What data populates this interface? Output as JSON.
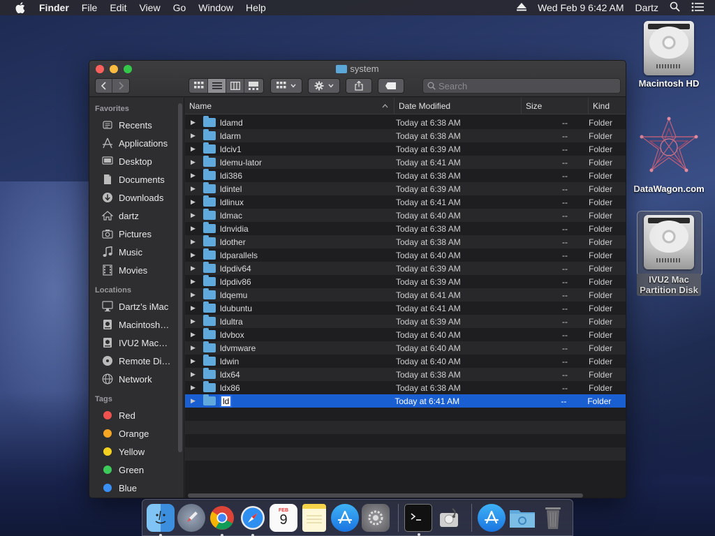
{
  "menubar": {
    "app_name": "Finder",
    "menus": [
      "File",
      "Edit",
      "View",
      "Go",
      "Window",
      "Help"
    ],
    "clock": "Wed Feb 9  6:42 AM",
    "user": "Dartz"
  },
  "desktop": {
    "icons": [
      {
        "label": "Macintosh HD",
        "icon": "hard-drive-icon"
      },
      {
        "label": "DataWagon.com",
        "icon": "star-mesh-icon"
      },
      {
        "label_line1": "IVU2 Mac",
        "label_line2": "Partition Disk",
        "icon": "hard-drive-icon",
        "selected": true
      }
    ]
  },
  "window": {
    "title": "system",
    "search_placeholder": "Search",
    "toolbar": {
      "view_modes": [
        "icon-view",
        "list-view",
        "column-view",
        "gallery-view"
      ],
      "active_view": "list-view"
    }
  },
  "sidebar": {
    "favorites_label": "Favorites",
    "favorites": [
      {
        "label": "Recents",
        "icon": "clock-icon"
      },
      {
        "label": "Applications",
        "icon": "applications-icon"
      },
      {
        "label": "Desktop",
        "icon": "desktop-icon"
      },
      {
        "label": "Documents",
        "icon": "document-icon"
      },
      {
        "label": "Downloads",
        "icon": "download-icon"
      },
      {
        "label": "dartz",
        "icon": "home-icon"
      },
      {
        "label": "Pictures",
        "icon": "camera-icon"
      },
      {
        "label": "Music",
        "icon": "music-icon"
      },
      {
        "label": "Movies",
        "icon": "film-icon"
      }
    ],
    "locations_label": "Locations",
    "locations": [
      {
        "label": "Dartz’s iMac",
        "icon": "imac-icon"
      },
      {
        "label": "Macintosh…",
        "icon": "disk-icon"
      },
      {
        "label": "IVU2 Mac…",
        "icon": "disk-icon"
      },
      {
        "label": "Remote Di…",
        "icon": "optical-disc-icon"
      },
      {
        "label": "Network",
        "icon": "globe-icon"
      }
    ],
    "tags_label": "Tags",
    "tags": [
      {
        "label": "Red",
        "color": "#f0524f"
      },
      {
        "label": "Orange",
        "color": "#f5a623"
      },
      {
        "label": "Yellow",
        "color": "#f5d020"
      },
      {
        "label": "Green",
        "color": "#3ec95b"
      },
      {
        "label": "Blue",
        "color": "#3a8ff2"
      }
    ]
  },
  "list": {
    "columns": {
      "name": "Name",
      "date": "Date Modified",
      "size": "Size",
      "kind": "Kind"
    },
    "rows": [
      {
        "name": "ldamd",
        "date": "Today at 6:38 AM",
        "size": "--",
        "kind": "Folder"
      },
      {
        "name": "ldarm",
        "date": "Today at 6:38 AM",
        "size": "--",
        "kind": "Folder"
      },
      {
        "name": "ldciv1",
        "date": "Today at 6:39 AM",
        "size": "--",
        "kind": "Folder"
      },
      {
        "name": "ldemu-lator",
        "date": "Today at 6:41 AM",
        "size": "--",
        "kind": "Folder"
      },
      {
        "name": "ldi386",
        "date": "Today at 6:38 AM",
        "size": "--",
        "kind": "Folder"
      },
      {
        "name": "ldintel",
        "date": "Today at 6:39 AM",
        "size": "--",
        "kind": "Folder"
      },
      {
        "name": "ldlinux",
        "date": "Today at 6:41 AM",
        "size": "--",
        "kind": "Folder"
      },
      {
        "name": "ldmac",
        "date": "Today at 6:40 AM",
        "size": "--",
        "kind": "Folder"
      },
      {
        "name": "ldnvidia",
        "date": "Today at 6:38 AM",
        "size": "--",
        "kind": "Folder"
      },
      {
        "name": "ldother",
        "date": "Today at 6:38 AM",
        "size": "--",
        "kind": "Folder"
      },
      {
        "name": "ldparallels",
        "date": "Today at 6:40 AM",
        "size": "--",
        "kind": "Folder"
      },
      {
        "name": "ldpdiv64",
        "date": "Today at 6:39 AM",
        "size": "--",
        "kind": "Folder"
      },
      {
        "name": "ldpdiv86",
        "date": "Today at 6:39 AM",
        "size": "--",
        "kind": "Folder"
      },
      {
        "name": "ldqemu",
        "date": "Today at 6:41 AM",
        "size": "--",
        "kind": "Folder"
      },
      {
        "name": "ldubuntu",
        "date": "Today at 6:41 AM",
        "size": "--",
        "kind": "Folder"
      },
      {
        "name": "ldultra",
        "date": "Today at 6:39 AM",
        "size": "--",
        "kind": "Folder"
      },
      {
        "name": "ldvbox",
        "date": "Today at 6:40 AM",
        "size": "--",
        "kind": "Folder"
      },
      {
        "name": "ldvmware",
        "date": "Today at 6:40 AM",
        "size": "--",
        "kind": "Folder"
      },
      {
        "name": "ldwin",
        "date": "Today at 6:40 AM",
        "size": "--",
        "kind": "Folder"
      },
      {
        "name": "ldx64",
        "date": "Today at 6:38 AM",
        "size": "--",
        "kind": "Folder"
      },
      {
        "name": "ldx86",
        "date": "Today at 6:38 AM",
        "size": "--",
        "kind": "Folder"
      },
      {
        "name": "ld",
        "date": "Today at 6:41 AM",
        "size": "--",
        "kind": "Folder",
        "selected": true,
        "editing": true
      }
    ]
  },
  "dock": {
    "calendar_day": "9",
    "calendar_month": "FEB",
    "apps": [
      "finder-icon",
      "launchpad-icon",
      "chrome-icon",
      "safari-icon",
      "calendar-icon",
      "notes-icon",
      "app-store-icon",
      "system-preferences-icon",
      "terminal-icon",
      "disk-utility-icon",
      "app-store-download-icon",
      "folder-icon",
      "trash-icon"
    ]
  }
}
